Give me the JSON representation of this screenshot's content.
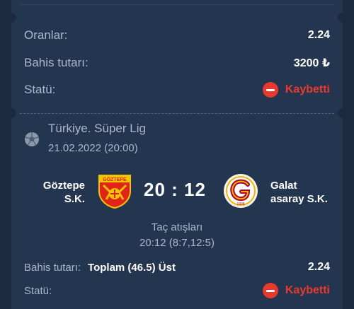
{
  "summary": {
    "odds_label": "Oranlar:",
    "odds_value": "2.24",
    "stake_label": "Bahis tutarı:",
    "stake_value": "3200 ₺",
    "status_label": "Statü:",
    "status_value": "Kaybetti"
  },
  "event": {
    "league": "Türkiye. Süper Lig",
    "date": "21.02.2022 (20:00)",
    "home_team_line1": "Göztepe",
    "home_team_line2": "S.K.",
    "away_team_line1": "Galat",
    "away_team_line2": "asaray S.K.",
    "score": "20 : 12",
    "market_name": "Taç atışları",
    "market_result": "20:12 (8:7,12:5)",
    "home_logo_text": "GÖZTEPE",
    "away_logo_text": "1905"
  },
  "bet": {
    "stake_label": "Bahis tutarı:",
    "selection": "Toplam (46.5) Üst",
    "odds": "2.24",
    "status_label": "Statü:",
    "status_value": "Kaybetti"
  },
  "colors": {
    "background": "#1b2a3e",
    "card": "#24364f",
    "label": "#a8b8cc",
    "lost": "#e8392e"
  },
  "icons": {
    "status": "minus-circle-icon",
    "league": "soccer-ball-icon"
  }
}
